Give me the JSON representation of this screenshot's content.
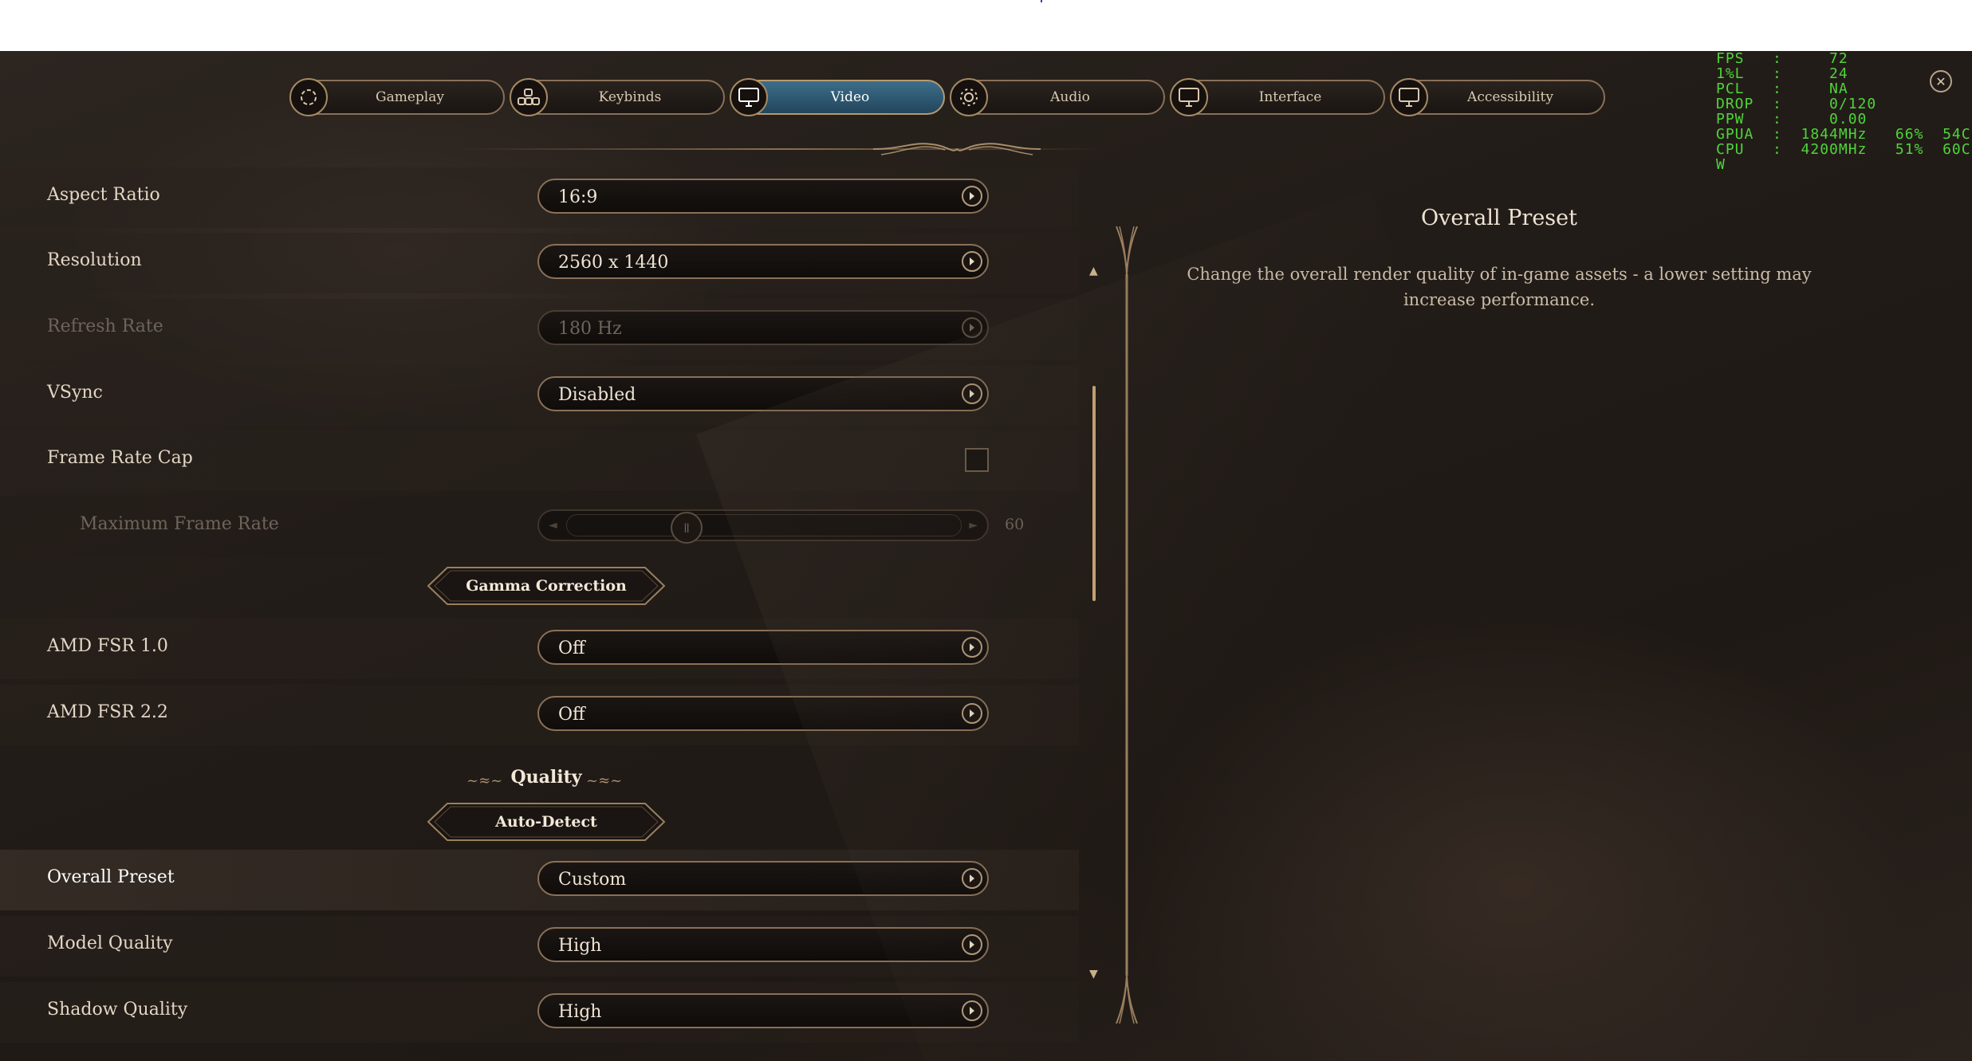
{
  "tabs": [
    {
      "label": "Gameplay",
      "icon": "gameplay-icon"
    },
    {
      "label": "Keybinds",
      "icon": "keybinds-icon"
    },
    {
      "label": "Video",
      "icon": "monitor-icon",
      "active": true
    },
    {
      "label": "Audio",
      "icon": "audio-icon"
    },
    {
      "label": "Interface",
      "icon": "monitor-icon"
    },
    {
      "label": "Accessibility",
      "icon": "monitor-icon"
    }
  ],
  "perf_overlay": {
    "lines": [
      "FPS   :     72",
      "1%L   :     24",
      "PCL   :     NA",
      "DROP  :     0/120",
      "PPW   :     0.00",
      "GPUA  :  1844MHz   66%  54C",
      "CPU   :  4200MHz   51%  60C",
      "W"
    ]
  },
  "settings": {
    "aspect_ratio": {
      "label": "Aspect Ratio",
      "value": "16:9"
    },
    "resolution": {
      "label": "Resolution",
      "value": "2560 x 1440"
    },
    "refresh_rate": {
      "label": "Refresh Rate",
      "value": "180 Hz"
    },
    "vsync": {
      "label": "VSync",
      "value": "Disabled"
    },
    "frame_rate_cap": {
      "label": "Frame Rate Cap",
      "checked": false
    },
    "max_frame_rate": {
      "label": "Maximum Frame Rate",
      "value": "60"
    },
    "gamma_button": "Gamma Correction",
    "amd_fsr_1": {
      "label": "AMD FSR 1.0",
      "value": "Off"
    },
    "amd_fsr_2": {
      "label": "AMD FSR 2.2",
      "value": "Off"
    },
    "quality_heading": "Quality",
    "auto_detect_button": "Auto-Detect",
    "overall_preset": {
      "label": "Overall Preset",
      "value": "Custom"
    },
    "model_quality": {
      "label": "Model Quality",
      "value": "High"
    },
    "shadow_quality": {
      "label": "Shadow Quality",
      "value": "High"
    }
  },
  "info_panel": {
    "title": "Overall Preset",
    "description": "Change the overall render quality of in-game assets - a lower setting may increase performance."
  },
  "colors": {
    "accent_active_tab": "#2f5a73",
    "border_gold": "#8a7058",
    "perf_green": "#4fd43a",
    "scroll_thumb": "#c9a678"
  }
}
